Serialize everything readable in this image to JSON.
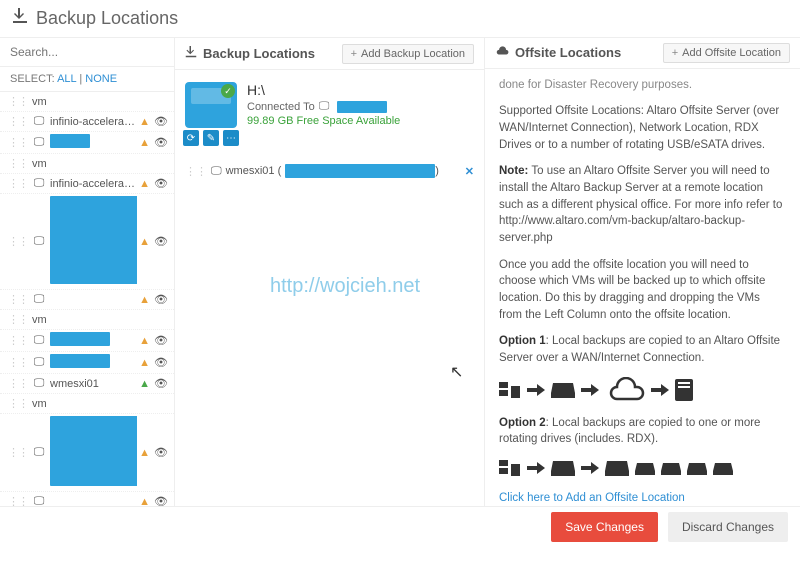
{
  "page_title": "Backup Locations",
  "left": {
    "search_placeholder": "Search...",
    "select_label": "SELECT:",
    "select_all": "ALL",
    "select_none": "NONE",
    "rows": [
      {
        "icon": "vm",
        "label": ""
      },
      {
        "icon": "monitor",
        "label": "infinio-acceleratorlabed…",
        "warn": true,
        "eye": true
      },
      {
        "icon": "monitor",
        "label": "",
        "warn": true,
        "eye": true,
        "bluebar": 40
      },
      {
        "icon": "vm",
        "label": ""
      },
      {
        "icon": "monitor",
        "label": "infinio-acceleratorlabed…",
        "warn": true,
        "eye": true
      },
      {
        "icon": "monitor",
        "label": "",
        "warn": true,
        "eye": true,
        "block": 88
      },
      {
        "icon": "monitor",
        "label": "",
        "warn": true,
        "eye": true
      },
      {
        "icon": "vm",
        "label": ""
      },
      {
        "icon": "monitor",
        "label": "",
        "warn": true,
        "eye": true,
        "bluebar": 60
      },
      {
        "icon": "monitor",
        "label": "",
        "warn": true,
        "eye": true,
        "bluebar": 60
      },
      {
        "icon": "monitor",
        "label": "wmesxi01",
        "ok": true,
        "eye": true
      },
      {
        "icon": "vm",
        "label": ""
      },
      {
        "icon": "monitor",
        "label": "",
        "warn": true,
        "eye": true,
        "block": 70
      },
      {
        "icon": "monitor",
        "label": "",
        "warn": true,
        "eye": true
      },
      {
        "icon": "monitor",
        "label": "",
        "warn": true,
        "eye": true
      }
    ]
  },
  "mid": {
    "header": "Backup Locations",
    "add_label": "Add Backup Location",
    "drive": {
      "name": "H:\\",
      "connected": "Connected To",
      "free": "99.89 GB Free Space Available"
    },
    "mapped_host": "wmesxi01 ("
  },
  "right": {
    "header": "Offsite Locations",
    "add_label": "Add Offsite Location",
    "p0": "done for Disaster Recovery purposes.",
    "p1": "Supported Offsite Locations: Altaro Offsite Server (over WAN/Internet Connection), Network Location, RDX Drives or to a number of rotating USB/eSATA drives.",
    "note_label": "Note:",
    "p2": " To use an Altaro Offsite Server you will need to install the Altaro Backup Server at a remote location such as a different physical office. For more info refer to http://www.altaro.com/vm-backup/altaro-backup-server.php",
    "p3": "Once you add the offsite location you will need to choose which VMs will be backed up to which offsite location. Do this by dragging and dropping the VMs from the Left Column onto the offsite location.",
    "opt1_label": "Option 1",
    "opt1": ": Local backups are copied to an Altaro Offsite Server over a WAN/Internet Connection.",
    "opt2_label": "Option 2",
    "opt2": ": Local backups are copied to one or more rotating drives (includes. RDX).",
    "link": "Click here to Add an Offsite Location"
  },
  "footer": {
    "save": "Save Changes",
    "discard": "Discard Changes"
  },
  "watermark": "http://wojcieh.net"
}
